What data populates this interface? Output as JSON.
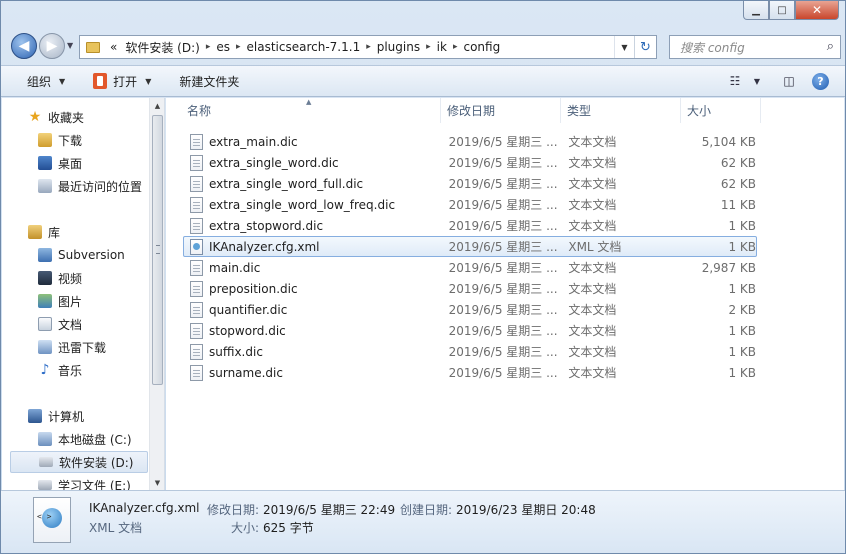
{
  "window": {
    "minimize": "▁",
    "maximize": "□",
    "close": "✕"
  },
  "nav": {
    "back_glyph": "◀",
    "forward_glyph": "▶",
    "overflow": "«",
    "path": [
      "软件安装 (D:)",
      "es",
      "elasticsearch-7.1.1",
      "plugins",
      "ik",
      "config"
    ],
    "search_placeholder": "搜索 config"
  },
  "toolbar": {
    "organize": "组织",
    "open": "打开",
    "new_folder": "新建文件夹"
  },
  "sidebar": {
    "favorites": {
      "label": "收藏夹",
      "items": [
        "下载",
        "桌面",
        "最近访问的位置"
      ]
    },
    "libraries": {
      "label": "库",
      "items": [
        "Subversion",
        "视频",
        "图片",
        "文档",
        "迅雷下载",
        "音乐"
      ]
    },
    "computer": {
      "label": "计算机",
      "items": [
        "本地磁盘 (C:)",
        "软件安装 (D:)",
        "学习文件 (E:)"
      ]
    }
  },
  "columns": {
    "name": "名称",
    "date": "修改日期",
    "type": "类型",
    "size": "大小"
  },
  "files": [
    {
      "name": "extra_main.dic",
      "date": "2019/6/5 星期三 ...",
      "type": "文本文档",
      "size": "5,104 KB"
    },
    {
      "name": "extra_single_word.dic",
      "date": "2019/6/5 星期三 ...",
      "type": "文本文档",
      "size": "62 KB"
    },
    {
      "name": "extra_single_word_full.dic",
      "date": "2019/6/5 星期三 ...",
      "type": "文本文档",
      "size": "62 KB"
    },
    {
      "name": "extra_single_word_low_freq.dic",
      "date": "2019/6/5 星期三 ...",
      "type": "文本文档",
      "size": "11 KB"
    },
    {
      "name": "extra_stopword.dic",
      "date": "2019/6/5 星期三 ...",
      "type": "文本文档",
      "size": "1 KB"
    },
    {
      "name": "IKAnalyzer.cfg.xml",
      "date": "2019/6/5 星期三 ...",
      "type": "XML 文档",
      "size": "1 KB"
    },
    {
      "name": "main.dic",
      "date": "2019/6/5 星期三 ...",
      "type": "文本文档",
      "size": "2,987 KB"
    },
    {
      "name": "preposition.dic",
      "date": "2019/6/5 星期三 ...",
      "type": "文本文档",
      "size": "1 KB"
    },
    {
      "name": "quantifier.dic",
      "date": "2019/6/5 星期三 ...",
      "type": "文本文档",
      "size": "2 KB"
    },
    {
      "name": "stopword.dic",
      "date": "2019/6/5 星期三 ...",
      "type": "文本文档",
      "size": "1 KB"
    },
    {
      "name": "suffix.dic",
      "date": "2019/6/5 星期三 ...",
      "type": "文本文档",
      "size": "1 KB"
    },
    {
      "name": "surname.dic",
      "date": "2019/6/5 星期三 ...",
      "type": "文本文档",
      "size": "1 KB"
    }
  ],
  "details": {
    "name": "IKAnalyzer.cfg.xml",
    "type": "XML 文档",
    "modified_label": "修改日期:",
    "modified_value": "2019/6/5 星期三 22:49",
    "created_label": "创建日期:",
    "created_value": "2019/6/23 星期日 20:48",
    "size_label": "大小:",
    "size_value": "625 字节"
  },
  "colors": {
    "selection_border": "#86aee0",
    "accent": "#2e64b2"
  }
}
